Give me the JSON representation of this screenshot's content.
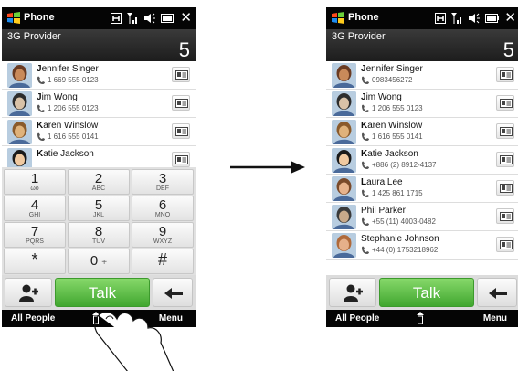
{
  "app_title": "Phone",
  "provider": "3G Provider",
  "missed_count": "5",
  "left_contacts": [
    {
      "initial": "J",
      "rest": "ennifer Singer",
      "number": "1 669 555 0123"
    },
    {
      "initial": "J",
      "rest": "im Wong",
      "number": "1 206 555 0123"
    },
    {
      "initial": "K",
      "rest": "aren Winslow",
      "number": "1 616 555 0141"
    },
    {
      "initial": "K",
      "rest": "atie Jackson",
      "number": ""
    }
  ],
  "right_contacts": [
    {
      "initial": "J",
      "rest": "ennifer Singer",
      "number": "0983456272"
    },
    {
      "initial": "J",
      "rest": "im Wong",
      "number": "1 206 555 0123"
    },
    {
      "initial": "K",
      "rest": "aren Winslow",
      "number": "1 616 555 0141"
    },
    {
      "initial": "K",
      "rest": "atie Jackson",
      "number": "+886 (2) 8912-4137"
    },
    {
      "initial": "L",
      "rest": "aura Lee",
      "number": "1 425 861 1715"
    },
    {
      "initial": "",
      "rest": "Phil Parker",
      "number": "+55 (11) 4003-0482"
    },
    {
      "initial": "",
      "rest": "Stephanie Johnson",
      "number": "+44 (0) 1753218962"
    }
  ],
  "keypad": [
    {
      "digit": "1",
      "letters": "ωο"
    },
    {
      "digit": "2",
      "letters": "ABC"
    },
    {
      "digit": "3",
      "letters": "DEF"
    },
    {
      "digit": "4",
      "letters": "GHI"
    },
    {
      "digit": "5",
      "letters": "JKL"
    },
    {
      "digit": "6",
      "letters": "MNO"
    },
    {
      "digit": "7",
      "letters": "PQRS"
    },
    {
      "digit": "8",
      "letters": "TUV"
    },
    {
      "digit": "9",
      "letters": "WXYZ"
    },
    {
      "digit": "*",
      "letters": ""
    },
    {
      "digit": "0",
      "letters": "+"
    },
    {
      "digit": "#",
      "letters": ""
    }
  ],
  "talk_label": "Talk",
  "softkey_left": "All People",
  "softkey_right": "Menu",
  "icons": {
    "windows": "windows-logo-icon",
    "h_network": "hsdpa-icon",
    "signal": "signal-icon",
    "volume": "volume-icon",
    "battery": "battery-icon",
    "close": "close-icon",
    "contact_card": "contact-card-icon",
    "phone": "phone-handset-icon",
    "people": "people-icon",
    "backspace": "backspace-arrow-icon",
    "slide_up": "slide-up-handle-icon"
  },
  "colors": {
    "talk_green": "#4cb83a",
    "bar_black": "#050505"
  }
}
